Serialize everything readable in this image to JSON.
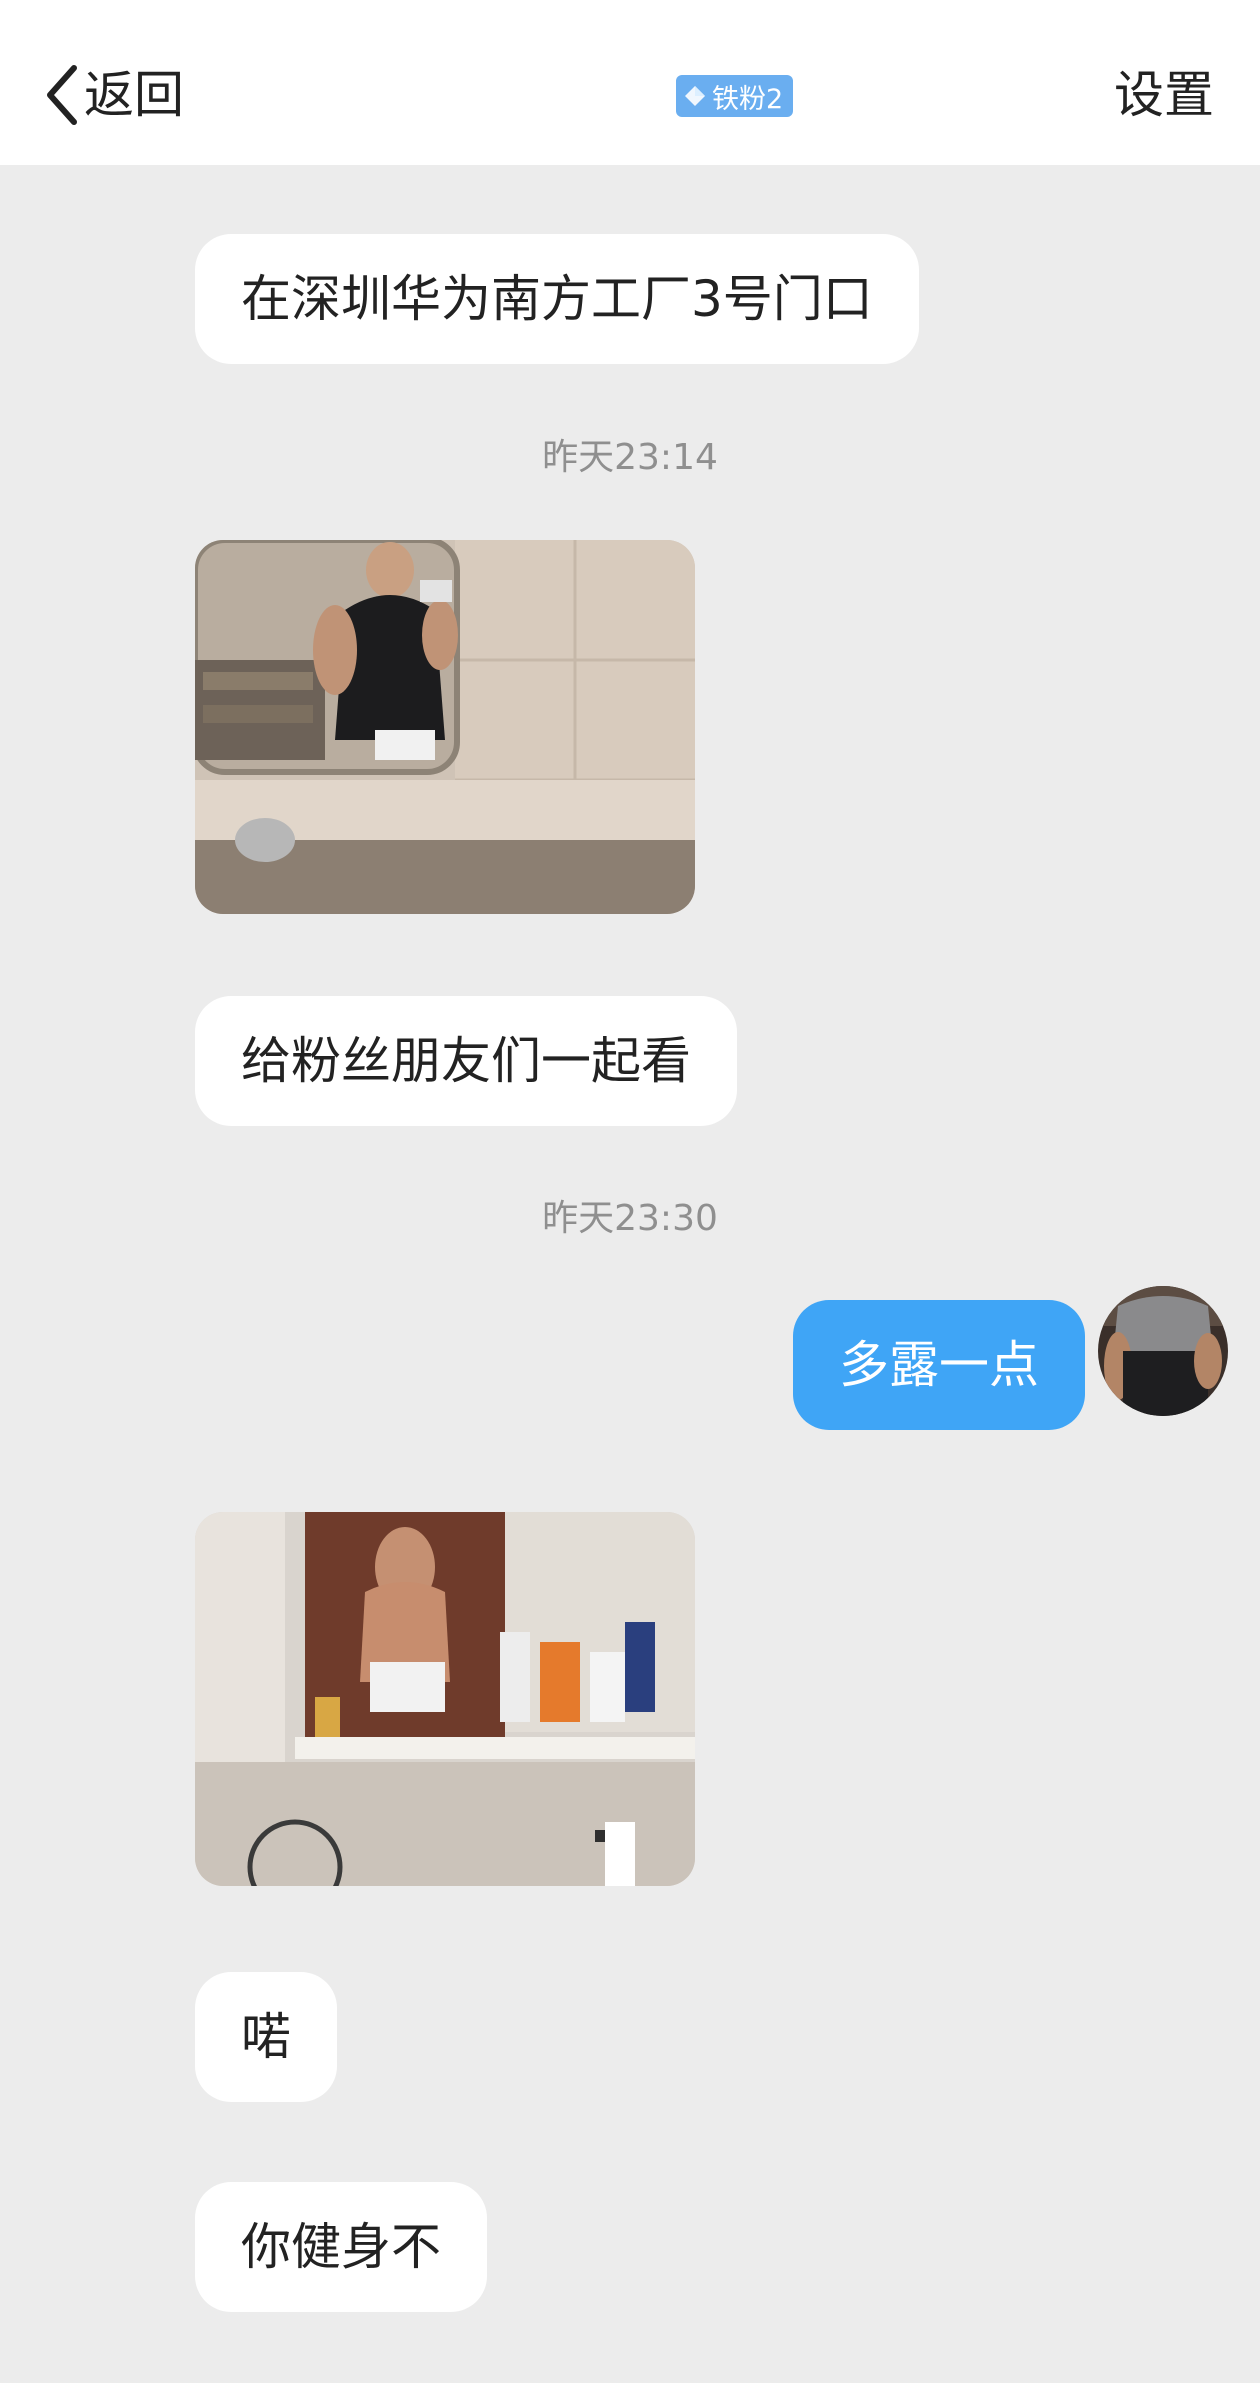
{
  "header": {
    "back_label": "返回",
    "badge_label": "铁粉2",
    "settings_label": "设置"
  },
  "messages": [
    {
      "type": "text",
      "from": "other",
      "text": "在深圳华为南方工厂3号门口"
    },
    {
      "type": "timestamp",
      "text": "昨天23:14"
    },
    {
      "type": "image",
      "from": "other"
    },
    {
      "type": "text",
      "from": "other",
      "text": "给粉丝朋友们一起看"
    },
    {
      "type": "timestamp",
      "text": "昨天23:30"
    },
    {
      "type": "text",
      "from": "self",
      "text": "多露一点"
    },
    {
      "type": "image",
      "from": "other"
    },
    {
      "type": "text",
      "from": "other",
      "text": "喏"
    },
    {
      "type": "text",
      "from": "other",
      "text": "你健身不"
    }
  ],
  "colors": {
    "header_bg": "#ffffff",
    "chat_bg": "#ececec",
    "self_bubble": "#3fa5f6",
    "other_bubble": "#ffffff",
    "badge_bg": "#6aaef0",
    "timestamp_text": "#8f8f8f"
  },
  "icons": {
    "back": "chevron-left-icon",
    "badge": "diamond-icon"
  }
}
